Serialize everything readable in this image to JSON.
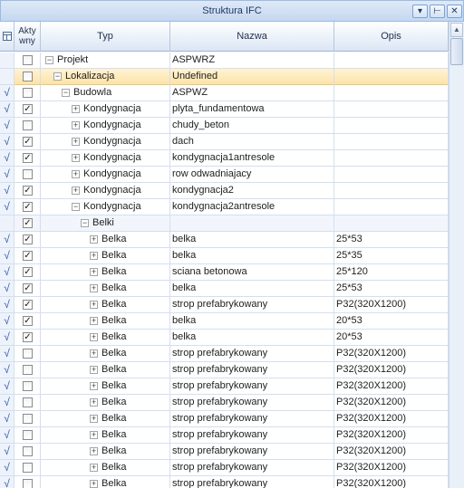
{
  "panel": {
    "title": "Struktura IFC",
    "buttons": [
      {
        "icon": "dropdown-arrow-icon",
        "glyph": "▾"
      },
      {
        "icon": "pin-icon",
        "glyph": "⊢"
      },
      {
        "icon": "close-icon",
        "glyph": "✕"
      }
    ]
  },
  "columns": {
    "tree_icon": "tree-grid-icon",
    "aktywny_line1": "Akty",
    "aktywny_line2": "wny",
    "typ": "Typ",
    "nazwa": "Nazwa",
    "opis": "Opis"
  },
  "rows": [
    {
      "mark": "",
      "checked": false,
      "level": 0,
      "expander": "−",
      "typ": "Projekt",
      "nazwa": "ASPWRZ",
      "opis": ""
    },
    {
      "mark": "",
      "checked": false,
      "level": 1,
      "expander": "−",
      "typ": "Lokalizacja",
      "nazwa": "Undefined",
      "opis": "",
      "selected": true
    },
    {
      "mark": "√",
      "checked": false,
      "level": 2,
      "expander": "−",
      "typ": "Budowla",
      "nazwa": "ASPWZ",
      "opis": ""
    },
    {
      "mark": "√",
      "checked": true,
      "level": 3,
      "expander": "+",
      "typ": "Kondygnacja",
      "nazwa": "plyta_fundamentowa",
      "opis": ""
    },
    {
      "mark": "√",
      "checked": false,
      "level": 3,
      "expander": "+",
      "typ": "Kondygnacja",
      "nazwa": "chudy_beton",
      "opis": ""
    },
    {
      "mark": "√",
      "checked": true,
      "level": 3,
      "expander": "+",
      "typ": "Kondygnacja",
      "nazwa": "dach",
      "opis": ""
    },
    {
      "mark": "√",
      "checked": true,
      "level": 3,
      "expander": "+",
      "typ": "Kondygnacja",
      "nazwa": "kondygnacja1antresole",
      "opis": ""
    },
    {
      "mark": "√",
      "checked": false,
      "level": 3,
      "expander": "+",
      "typ": "Kondygnacja",
      "nazwa": "row odwadniajacy",
      "opis": ""
    },
    {
      "mark": "√",
      "checked": true,
      "level": 3,
      "expander": "+",
      "typ": "Kondygnacja",
      "nazwa": "kondygnacja2",
      "opis": ""
    },
    {
      "mark": "√",
      "checked": true,
      "level": 3,
      "expander": "−",
      "typ": "Kondygnacja",
      "nazwa": "kondygnacja2antresole",
      "opis": ""
    },
    {
      "mark": "",
      "checked": true,
      "level": 4,
      "expander": "−",
      "typ": "Belki",
      "nazwa": "",
      "opis": "",
      "group": true
    },
    {
      "mark": "√",
      "checked": true,
      "level": 5,
      "expander": "+",
      "typ": "Belka",
      "nazwa": "belka",
      "opis": "25*53"
    },
    {
      "mark": "√",
      "checked": true,
      "level": 5,
      "expander": "+",
      "typ": "Belka",
      "nazwa": "belka",
      "opis": "25*35"
    },
    {
      "mark": "√",
      "checked": true,
      "level": 5,
      "expander": "+",
      "typ": "Belka",
      "nazwa": "sciana betonowa",
      "opis": "25*120"
    },
    {
      "mark": "√",
      "checked": true,
      "level": 5,
      "expander": "+",
      "typ": "Belka",
      "nazwa": "belka",
      "opis": "25*53"
    },
    {
      "mark": "√",
      "checked": true,
      "level": 5,
      "expander": "+",
      "typ": "Belka",
      "nazwa": "strop prefabrykowany",
      "opis": "P32(320X1200)"
    },
    {
      "mark": "√",
      "checked": true,
      "level": 5,
      "expander": "+",
      "typ": "Belka",
      "nazwa": "belka",
      "opis": "20*53"
    },
    {
      "mark": "√",
      "checked": true,
      "level": 5,
      "expander": "+",
      "typ": "Belka",
      "nazwa": "belka",
      "opis": "20*53"
    },
    {
      "mark": "√",
      "checked": false,
      "level": 5,
      "expander": "+",
      "typ": "Belka",
      "nazwa": "strop prefabrykowany",
      "opis": "P32(320X1200)"
    },
    {
      "mark": "√",
      "checked": false,
      "level": 5,
      "expander": "+",
      "typ": "Belka",
      "nazwa": "strop prefabrykowany",
      "opis": "P32(320X1200)"
    },
    {
      "mark": "√",
      "checked": false,
      "level": 5,
      "expander": "+",
      "typ": "Belka",
      "nazwa": "strop prefabrykowany",
      "opis": "P32(320X1200)"
    },
    {
      "mark": "√",
      "checked": false,
      "level": 5,
      "expander": "+",
      "typ": "Belka",
      "nazwa": "strop prefabrykowany",
      "opis": "P32(320X1200)"
    },
    {
      "mark": "√",
      "checked": false,
      "level": 5,
      "expander": "+",
      "typ": "Belka",
      "nazwa": "strop prefabrykowany",
      "opis": "P32(320X1200)"
    },
    {
      "mark": "√",
      "checked": false,
      "level": 5,
      "expander": "+",
      "typ": "Belka",
      "nazwa": "strop prefabrykowany",
      "opis": "P32(320X1200)"
    },
    {
      "mark": "√",
      "checked": false,
      "level": 5,
      "expander": "+",
      "typ": "Belka",
      "nazwa": "strop prefabrykowany",
      "opis": "P32(320X1200)"
    },
    {
      "mark": "√",
      "checked": false,
      "level": 5,
      "expander": "+",
      "typ": "Belka",
      "nazwa": "strop prefabrykowany",
      "opis": "P32(320X1200)"
    },
    {
      "mark": "√",
      "checked": false,
      "level": 5,
      "expander": "+",
      "typ": "Belka",
      "nazwa": "strop prefabrykowany",
      "opis": "P32(320X1200)"
    }
  ],
  "scrollbar": {
    "up_glyph": "▲"
  }
}
